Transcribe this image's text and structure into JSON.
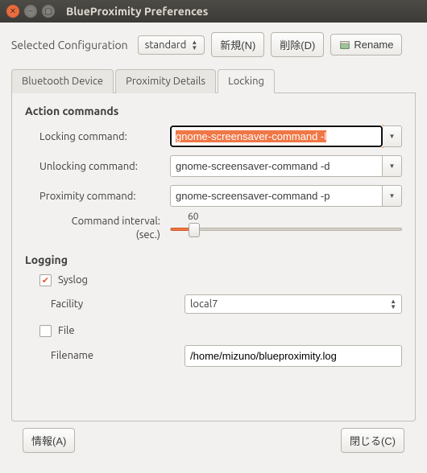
{
  "titlebar": {
    "title": "BlueProximity Preferences"
  },
  "config": {
    "label": "Selected Configuration",
    "selected": "standard",
    "new_btn": "新規(N)",
    "delete_btn": "削除(D)",
    "rename_btn": "Rename"
  },
  "tabs": {
    "bluetooth": "Bluetooth Device",
    "proximity": "Proximity Details",
    "locking": "Locking"
  },
  "action": {
    "heading": "Action commands",
    "locking_label": "Locking command:",
    "locking_value": "gnome-screensaver-command -l",
    "unlocking_label": "Unlocking command:",
    "unlocking_value": "gnome-screensaver-command -d",
    "proximity_label": "Proximity command:",
    "proximity_value": "gnome-screensaver-command -p",
    "interval_label": "Command interval:\n(sec.)",
    "interval_value": "60"
  },
  "logging": {
    "heading": "Logging",
    "syslog_label": "Syslog",
    "syslog_checked": true,
    "facility_label": "Facility",
    "facility_value": "local7",
    "file_label": "File",
    "file_checked": false,
    "filename_label": "Filename",
    "filename_value": "/home/mizuno/blueproximity.log"
  },
  "footer": {
    "info_btn": "情報(A)",
    "close_btn": "閉じる(C)"
  }
}
